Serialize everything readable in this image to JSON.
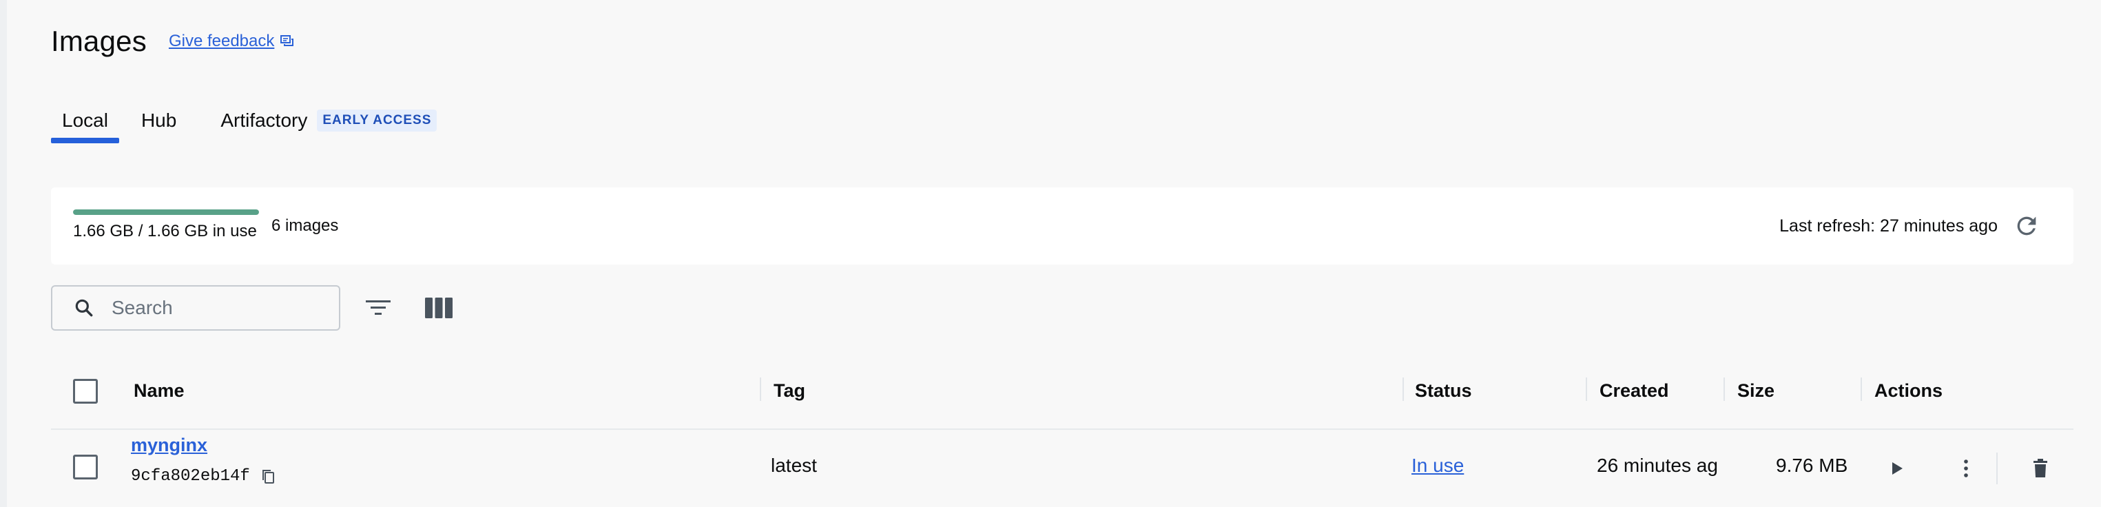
{
  "header": {
    "title": "Images",
    "feedback_label": "Give feedback"
  },
  "tabs": [
    {
      "label": "Local",
      "active": true
    },
    {
      "label": "Hub",
      "active": false
    },
    {
      "label": "Artifactory",
      "active": false,
      "badge": "EARLY ACCESS"
    }
  ],
  "usage": {
    "text": "1.66 GB / 1.66 GB in use",
    "fraction_used": 1.0,
    "images_count": "6 images",
    "last_refresh": "Last refresh: 27 minutes ago"
  },
  "search": {
    "placeholder": "Search",
    "value": ""
  },
  "table": {
    "columns": [
      "Name",
      "Tag",
      "Status",
      "Created",
      "Size",
      "Actions"
    ],
    "rows": [
      {
        "name": "mynginx",
        "id": "9cfa802eb14f",
        "tag": "latest",
        "status": "In use",
        "created": "26 minutes ag",
        "size": "9.76 MB"
      }
    ]
  },
  "icons": {
    "feedback": "chat-icon",
    "refresh": "refresh-icon",
    "search": "search-icon",
    "filter": "filter-icon",
    "columns": "columns-icon",
    "copy": "copy-icon",
    "run": "play-icon",
    "more": "more-vertical-icon",
    "delete": "trash-icon"
  },
  "colors": {
    "accent": "#2560da",
    "link": "#2a61d8",
    "usage_fill": "#58a188"
  }
}
